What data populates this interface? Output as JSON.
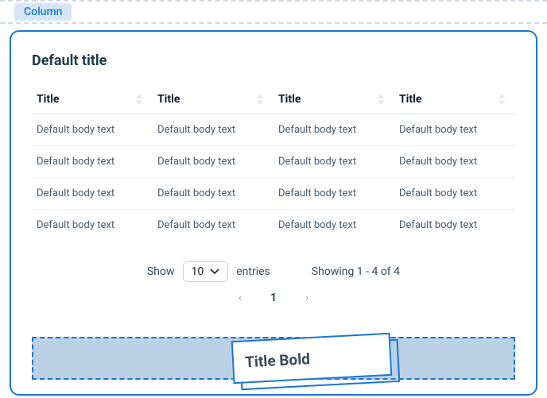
{
  "topbar": {
    "tab_label": "Column"
  },
  "card": {
    "title": "Default title",
    "columns": [
      "Title",
      "Title",
      "Title",
      "Title"
    ],
    "rows": [
      [
        "Default body text",
        "Default body text",
        "Default body text",
        "Default body text"
      ],
      [
        "Default body text",
        "Default body text",
        "Default body text",
        "Default body text"
      ],
      [
        "Default body text",
        "Default body text",
        "Default body text",
        "Default body text"
      ],
      [
        "Default body text",
        "Default body text",
        "Default body text",
        "Default body text"
      ]
    ]
  },
  "footer": {
    "show_label": "Show",
    "page_size": "10",
    "entries_label": "entries",
    "showing_label": "Showing 1 - 4 of 4"
  },
  "pager": {
    "prev": "‹",
    "current": "1",
    "next": "›"
  },
  "drag": {
    "label": "Title Bold"
  }
}
